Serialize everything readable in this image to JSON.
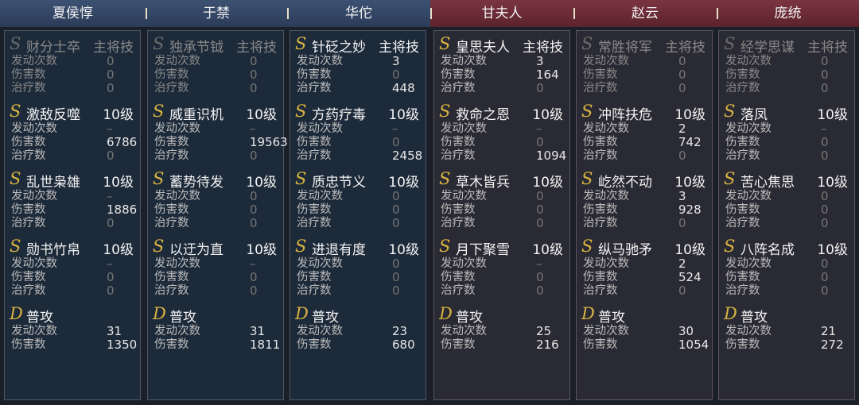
{
  "columns": [
    {
      "name": "夏侯惇",
      "side": "blue",
      "skills": [
        {
          "grade": "S",
          "name": "财分士卒",
          "level": "主将技",
          "dim": true,
          "rows": [
            {
              "label": "发动次数",
              "value": "0"
            },
            {
              "label": "伤害数",
              "value": "0"
            },
            {
              "label": "治疗数",
              "value": "0"
            }
          ]
        },
        {
          "grade": "S",
          "name": "激敌反噬",
          "level": "10级",
          "dim": false,
          "rows": [
            {
              "label": "发动次数",
              "value": "–"
            },
            {
              "label": "伤害数",
              "value": "6786"
            },
            {
              "label": "治疗数",
              "value": "0"
            }
          ]
        },
        {
          "grade": "S",
          "name": "乱世枭雄",
          "level": "10级",
          "dim": false,
          "rows": [
            {
              "label": "发动次数",
              "value": "–"
            },
            {
              "label": "伤害数",
              "value": "1886"
            },
            {
              "label": "治疗数",
              "value": "0"
            }
          ]
        },
        {
          "grade": "S",
          "name": "勋书竹帛",
          "level": "10级",
          "dim": false,
          "rows": [
            {
              "label": "发动次数",
              "value": "–"
            },
            {
              "label": "伤害数",
              "value": "0"
            },
            {
              "label": "治疗数",
              "value": "0"
            }
          ]
        },
        {
          "grade": "D",
          "name": "普攻",
          "level": "",
          "dim": false,
          "rows": [
            {
              "label": "发动次数",
              "value": "31"
            },
            {
              "label": "伤害数",
              "value": "1350"
            }
          ]
        }
      ]
    },
    {
      "name": "于禁",
      "side": "blue",
      "skills": [
        {
          "grade": "S",
          "name": "独承节钺",
          "level": "主将技",
          "dim": true,
          "rows": [
            {
              "label": "发动次数",
              "value": "0"
            },
            {
              "label": "伤害数",
              "value": "0"
            },
            {
              "label": "治疗数",
              "value": "0"
            }
          ]
        },
        {
          "grade": "S",
          "name": "威重识机",
          "level": "10级",
          "dim": false,
          "rows": [
            {
              "label": "发动次数",
              "value": "–"
            },
            {
              "label": "伤害数",
              "value": "19563"
            },
            {
              "label": "治疗数",
              "value": "0"
            }
          ]
        },
        {
          "grade": "S",
          "name": "蓄势待发",
          "level": "10级",
          "dim": false,
          "rows": [
            {
              "label": "发动次数",
              "value": "0"
            },
            {
              "label": "伤害数",
              "value": "0"
            },
            {
              "label": "治疗数",
              "value": "0"
            }
          ]
        },
        {
          "grade": "S",
          "name": "以迂为直",
          "level": "10级",
          "dim": false,
          "rows": [
            {
              "label": "发动次数",
              "value": "–"
            },
            {
              "label": "伤害数",
              "value": "0"
            },
            {
              "label": "治疗数",
              "value": "0"
            }
          ]
        },
        {
          "grade": "D",
          "name": "普攻",
          "level": "",
          "dim": false,
          "rows": [
            {
              "label": "发动次数",
              "value": "31"
            },
            {
              "label": "伤害数",
              "value": "1811"
            }
          ]
        }
      ]
    },
    {
      "name": "华佗",
      "side": "blue",
      "skills": [
        {
          "grade": "S",
          "name": "针砭之妙",
          "level": "主将技",
          "dim": false,
          "rows": [
            {
              "label": "发动次数",
              "value": "3"
            },
            {
              "label": "伤害数",
              "value": "0"
            },
            {
              "label": "治疗数",
              "value": "448"
            }
          ]
        },
        {
          "grade": "S",
          "name": "方药疗毒",
          "level": "10级",
          "dim": false,
          "rows": [
            {
              "label": "发动次数",
              "value": "–"
            },
            {
              "label": "伤害数",
              "value": "0"
            },
            {
              "label": "治疗数",
              "value": "2458"
            }
          ]
        },
        {
          "grade": "S",
          "name": "质忠节义",
          "level": "10级",
          "dim": false,
          "rows": [
            {
              "label": "发动次数",
              "value": "0"
            },
            {
              "label": "伤害数",
              "value": "0"
            },
            {
              "label": "治疗数",
              "value": "0"
            }
          ]
        },
        {
          "grade": "S",
          "name": "进退有度",
          "level": "10级",
          "dim": false,
          "rows": [
            {
              "label": "发动次数",
              "value": "0"
            },
            {
              "label": "伤害数",
              "value": "0"
            },
            {
              "label": "治疗数",
              "value": "0"
            }
          ]
        },
        {
          "grade": "D",
          "name": "普攻",
          "level": "",
          "dim": false,
          "rows": [
            {
              "label": "发动次数",
              "value": "23"
            },
            {
              "label": "伤害数",
              "value": "680"
            }
          ]
        }
      ]
    },
    {
      "name": "甘夫人",
      "side": "red",
      "skills": [
        {
          "grade": "S",
          "name": "皇思夫人",
          "level": "主将技",
          "dim": false,
          "rows": [
            {
              "label": "发动次数",
              "value": "3"
            },
            {
              "label": "伤害数",
              "value": "164"
            },
            {
              "label": "治疗数",
              "value": "0"
            }
          ]
        },
        {
          "grade": "S",
          "name": "救命之恩",
          "level": "10级",
          "dim": false,
          "rows": [
            {
              "label": "发动次数",
              "value": "–"
            },
            {
              "label": "伤害数",
              "value": "0"
            },
            {
              "label": "治疗数",
              "value": "1094"
            }
          ]
        },
        {
          "grade": "S",
          "name": "草木皆兵",
          "level": "10级",
          "dim": false,
          "rows": [
            {
              "label": "发动次数",
              "value": "0"
            },
            {
              "label": "伤害数",
              "value": "0"
            },
            {
              "label": "治疗数",
              "value": "0"
            }
          ]
        },
        {
          "grade": "S",
          "name": "月下聚雪",
          "level": "10级",
          "dim": false,
          "rows": [
            {
              "label": "发动次数",
              "value": "–"
            },
            {
              "label": "伤害数",
              "value": "0"
            },
            {
              "label": "治疗数",
              "value": "0"
            }
          ]
        },
        {
          "grade": "D",
          "name": "普攻",
          "level": "",
          "dim": false,
          "rows": [
            {
              "label": "发动次数",
              "value": "25"
            },
            {
              "label": "伤害数",
              "value": "216"
            }
          ]
        }
      ]
    },
    {
      "name": "赵云",
      "side": "red",
      "skills": [
        {
          "grade": "S",
          "name": "常胜将军",
          "level": "主将技",
          "dim": true,
          "rows": [
            {
              "label": "发动次数",
              "value": "0"
            },
            {
              "label": "伤害数",
              "value": "0"
            },
            {
              "label": "治疗数",
              "value": "0"
            }
          ]
        },
        {
          "grade": "S",
          "name": "冲阵扶危",
          "level": "10级",
          "dim": false,
          "rows": [
            {
              "label": "发动次数",
              "value": "2"
            },
            {
              "label": "伤害数",
              "value": "742"
            },
            {
              "label": "治疗数",
              "value": "0"
            }
          ]
        },
        {
          "grade": "S",
          "name": "屹然不动",
          "level": "10级",
          "dim": false,
          "rows": [
            {
              "label": "发动次数",
              "value": "3"
            },
            {
              "label": "伤害数",
              "value": "928"
            },
            {
              "label": "治疗数",
              "value": "0"
            }
          ]
        },
        {
          "grade": "S",
          "name": "纵马驰矛",
          "level": "10级",
          "dim": false,
          "rows": [
            {
              "label": "发动次数",
              "value": "2"
            },
            {
              "label": "伤害数",
              "value": "524"
            },
            {
              "label": "治疗数",
              "value": "0"
            }
          ]
        },
        {
          "grade": "D",
          "name": "普攻",
          "level": "",
          "dim": false,
          "rows": [
            {
              "label": "发动次数",
              "value": "30"
            },
            {
              "label": "伤害数",
              "value": "1054"
            }
          ]
        }
      ]
    },
    {
      "name": "庞统",
      "side": "red",
      "skills": [
        {
          "grade": "S",
          "name": "经学思谋",
          "level": "主将技",
          "dim": true,
          "rows": [
            {
              "label": "发动次数",
              "value": "0"
            },
            {
              "label": "伤害数",
              "value": "0"
            },
            {
              "label": "治疗数",
              "value": "0"
            }
          ]
        },
        {
          "grade": "S",
          "name": "落凤",
          "level": "10级",
          "dim": false,
          "rows": [
            {
              "label": "发动次数",
              "value": "–"
            },
            {
              "label": "伤害数",
              "value": "0"
            },
            {
              "label": "治疗数",
              "value": "0"
            }
          ]
        },
        {
          "grade": "S",
          "name": "苦心焦思",
          "level": "10级",
          "dim": false,
          "rows": [
            {
              "label": "发动次数",
              "value": "0"
            },
            {
              "label": "伤害数",
              "value": "0"
            },
            {
              "label": "治疗数",
              "value": "0"
            }
          ]
        },
        {
          "grade": "S",
          "name": "八阵名成",
          "level": "10级",
          "dim": false,
          "rows": [
            {
              "label": "发动次数",
              "value": "0"
            },
            {
              "label": "伤害数",
              "value": "0"
            },
            {
              "label": "治疗数",
              "value": "0"
            }
          ]
        },
        {
          "grade": "D",
          "name": "普攻",
          "level": "",
          "dim": false,
          "rows": [
            {
              "label": "发动次数",
              "value": "21"
            },
            {
              "label": "伤害数",
              "value": "272"
            }
          ]
        }
      ]
    }
  ],
  "colors": {
    "grade_active": "#d9b441",
    "grade_dim": "#6b6b6b",
    "blue_header": "#34486a",
    "red_header": "#6c2c36"
  }
}
